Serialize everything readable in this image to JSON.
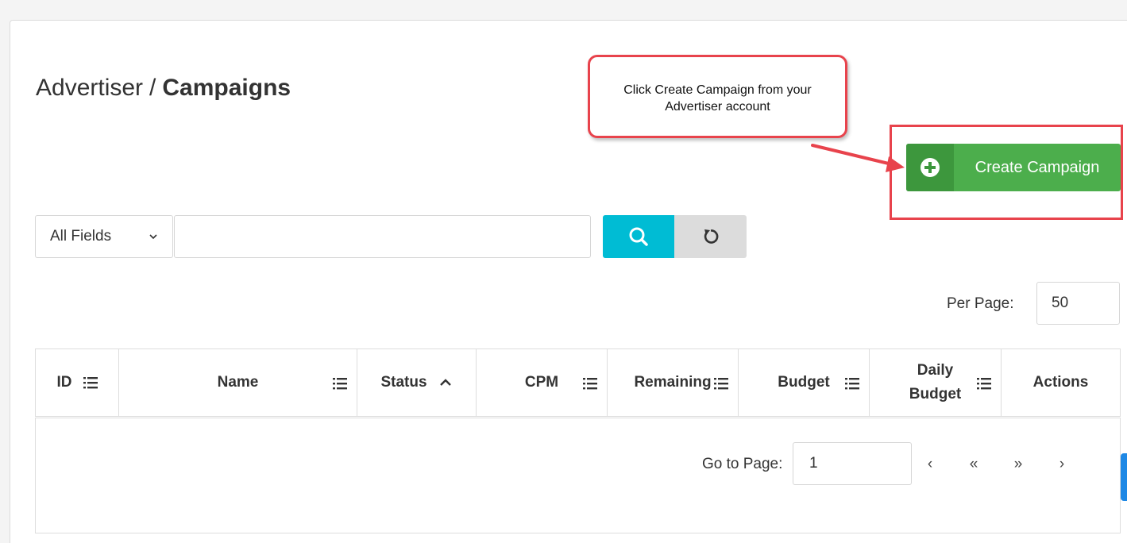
{
  "breadcrumb": {
    "parent": "Advertiser",
    "separator": "/",
    "current": "Campaigns"
  },
  "callout": {
    "line1": "Click Create Campaign from your",
    "line2": "Advertiser account"
  },
  "create_button": {
    "label": "Create Campaign"
  },
  "search": {
    "field_selected": "All Fields",
    "query": "",
    "placeholder": ""
  },
  "per_page": {
    "label": "Per Page:",
    "value": "50"
  },
  "table": {
    "columns": [
      "ID",
      "Name",
      "Status",
      "CPM",
      "Remaining",
      "Budget",
      "Daily",
      "Budget",
      "Actions"
    ]
  },
  "pagination": {
    "goto_label": "Go to Page:",
    "page": "1",
    "prev": "‹",
    "first": "«",
    "last": "»",
    "next": "›"
  },
  "colors": {
    "accent_green": "#4cae4c",
    "accent_green_dark": "#3d973d",
    "search_cyan": "#00bcd4",
    "highlight_red": "#e8434c"
  }
}
